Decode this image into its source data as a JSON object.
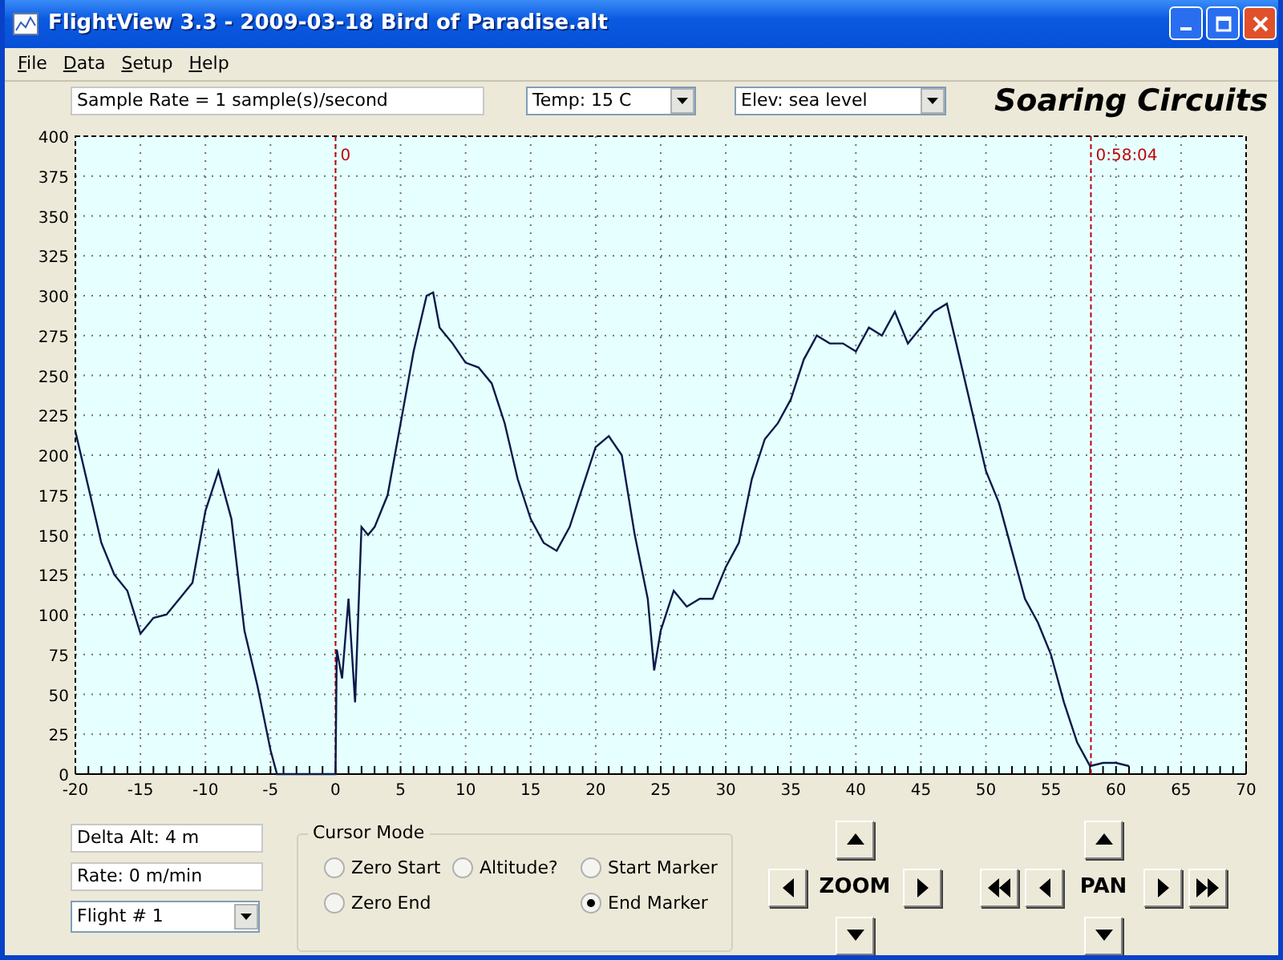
{
  "window": {
    "title": "FlightView 3.3 - 2009-03-18 Bird of Paradise.alt"
  },
  "menu": [
    "File",
    "Data",
    "Setup",
    "Help"
  ],
  "toolbar": {
    "sample_rate": "Sample Rate =  1 sample(s)/second",
    "temperature": "Temp:  15 C",
    "elevation": "Elev: sea level",
    "logo": "Soaring Circuits"
  },
  "chart": {
    "chart_data": {
      "type": "line",
      "xlim": [
        -20,
        70
      ],
      "ylim": [
        0,
        400
      ],
      "xticks": [
        -20,
        -15,
        -10,
        -5,
        0,
        5,
        10,
        15,
        20,
        25,
        30,
        35,
        40,
        45,
        50,
        55,
        60,
        65,
        70
      ],
      "yticks": [
        0,
        25,
        50,
        75,
        100,
        125,
        150,
        175,
        200,
        225,
        250,
        275,
        300,
        325,
        350,
        375,
        400
      ],
      "x": [
        -20,
        -19,
        -18,
        -17,
        -16,
        -15,
        -14,
        -13,
        -12,
        -11,
        -10,
        -9,
        -8,
        -7,
        -6,
        -5,
        -4.5,
        -4,
        -2,
        0,
        0.1,
        0.5,
        1,
        1.5,
        2,
        2.5,
        3,
        4,
        5,
        6,
        7,
        7.5,
        8,
        9,
        10,
        11,
        12,
        13,
        14,
        15,
        16,
        17,
        18,
        19,
        20,
        21,
        22,
        23,
        24,
        24.5,
        25,
        26,
        27,
        28,
        29,
        30,
        31,
        32,
        33,
        34,
        35,
        36,
        37,
        38,
        39,
        40,
        41,
        42,
        43,
        44,
        45,
        46,
        47,
        48,
        49,
        50,
        51,
        52,
        53,
        54,
        55,
        56,
        57,
        58,
        59,
        60,
        61
      ],
      "grid": true,
      "series": [
        {
          "color": "#0a1a4a",
          "values": [
            215,
            180,
            145,
            125,
            115,
            88,
            98,
            100,
            110,
            120,
            165,
            190,
            160,
            90,
            55,
            15,
            0,
            0,
            0,
            0,
            78,
            60,
            110,
            45,
            155,
            150,
            155,
            175,
            220,
            265,
            300,
            302,
            280,
            270,
            258,
            255,
            245,
            220,
            185,
            160,
            145,
            140,
            155,
            180,
            205,
            212,
            200,
            150,
            110,
            65,
            90,
            115,
            105,
            110,
            110,
            130,
            145,
            185,
            210,
            220,
            235,
            260,
            275,
            270,
            270,
            265,
            280,
            275,
            290,
            270,
            280,
            290,
            295,
            260,
            225,
            190,
            170,
            140,
            110,
            95,
            75,
            45,
            20,
            5,
            7,
            7,
            5
          ]
        }
      ],
      "ref_lines": [
        {
          "axis": "x",
          "value": 0,
          "label": "0",
          "color": "#c00000"
        },
        {
          "axis": "x",
          "value": 58.07,
          "label": "0:58:04",
          "color": "#c00000"
        }
      ]
    }
  },
  "readouts": {
    "delta_alt": "Delta Alt: 4 m",
    "rate": "Rate: 0 m/min",
    "flight": "Flight # 1"
  },
  "cursor_mode": {
    "title": "Cursor Mode",
    "options": [
      {
        "label": "Zero Start",
        "selected": false
      },
      {
        "label": "Altitude?",
        "selected": false
      },
      {
        "label": "Start Marker",
        "selected": false
      },
      {
        "label": "Zero End",
        "selected": false
      },
      {
        "label": "End Marker",
        "selected": true
      }
    ]
  },
  "zoom": {
    "label": "ZOOM"
  },
  "pan": {
    "label": "PAN"
  }
}
